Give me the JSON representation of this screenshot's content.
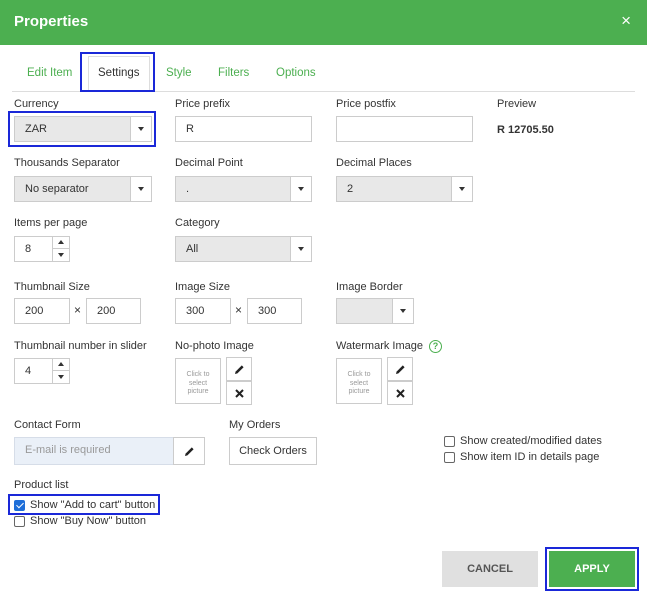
{
  "dialog": {
    "title": "Properties",
    "close_glyph": "×"
  },
  "tabs": {
    "edit_item": "Edit Item",
    "settings": "Settings",
    "style": "Style",
    "filters": "Filters",
    "options": "Options"
  },
  "currency": {
    "label": "Currency",
    "value": "ZAR"
  },
  "price_prefix": {
    "label": "Price prefix",
    "value": "R"
  },
  "price_postfix": {
    "label": "Price postfix",
    "value": ""
  },
  "preview": {
    "label": "Preview",
    "value": "R 12705.50"
  },
  "thousands_separator": {
    "label": "Thousands Separator",
    "value": "No separator"
  },
  "decimal_point": {
    "label": "Decimal Point",
    "value": "."
  },
  "decimal_places": {
    "label": "Decimal Places",
    "value": "2"
  },
  "items_per_page": {
    "label": "Items per page",
    "value": "8"
  },
  "category": {
    "label": "Category",
    "value": "All"
  },
  "thumbnail_size": {
    "label": "Thumbnail Size",
    "width": "200",
    "height": "200",
    "times": "×"
  },
  "image_size": {
    "label": "Image Size",
    "width": "300",
    "height": "300",
    "times": "×"
  },
  "image_border": {
    "label": "Image Border",
    "value": ""
  },
  "thumbnail_number": {
    "label": "Thumbnail number in slider",
    "value": "4"
  },
  "no_photo_image": {
    "label": "No-photo Image",
    "placeholder_lines": [
      "Click to",
      "select",
      "picture"
    ]
  },
  "watermark_image": {
    "label": "Watermark Image",
    "help_glyph": "?",
    "placeholder_lines": [
      "Click to",
      "select",
      "picture"
    ]
  },
  "contact_form": {
    "label": "Contact Form",
    "placeholder": "E-mail is required"
  },
  "my_orders": {
    "label": "My Orders",
    "button": "Check Orders"
  },
  "show_dates": {
    "label": "Show created/modified dates",
    "checked": false
  },
  "show_item_id": {
    "label": "Show item ID in details page",
    "checked": false
  },
  "product_list": {
    "label": "Product list",
    "add_to_cart": {
      "label": "Show \"Add to cart\" button",
      "checked": true
    },
    "buy_now": {
      "label": "Show \"Buy Now\" button",
      "checked": false
    }
  },
  "footer": {
    "cancel": "CANCEL",
    "apply": "APPLY"
  },
  "colors": {
    "accent": "#4caf50",
    "highlight": "#1a28d8",
    "checkbox": "#1e6ed8"
  },
  "icons": {
    "edit": "pencil-icon",
    "clear": "close-icon",
    "help": "help-icon"
  }
}
